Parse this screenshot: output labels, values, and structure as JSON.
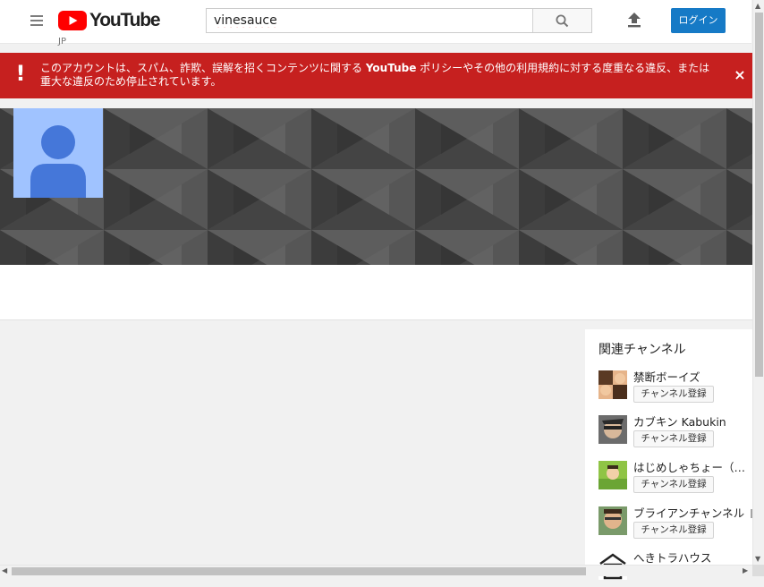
{
  "header": {
    "logo_text": "YouTube",
    "region": "JP",
    "search": {
      "value": "vinesauce",
      "placeholder": "検索"
    },
    "login_label": "ログイン",
    "brand_color": "#ff0000",
    "accent_color": "#167ac6"
  },
  "alert": {
    "icon": "!",
    "text_before": "このアカウントは、スパム、詐欺、誤解を招くコンテンツに関する ",
    "text_bold": "YouTube",
    "text_after": " ポリシーやその他の利用規約に対する度重なる違反、または重大な違反のため停止されています。",
    "close": "×",
    "color": "#c6201f"
  },
  "sidebar": {
    "title": "関連チャンネル",
    "subscribe_label": "チャンネル登録",
    "channels": [
      {
        "name": "禁断ボーイズ",
        "verified": false
      },
      {
        "name": "カブキン Kabukin",
        "verified": false
      },
      {
        "name": "はじめしゃちょー（hajime）",
        "verified": false
      },
      {
        "name": "ブライアンチャンネル",
        "verified": true
      },
      {
        "name": "へきトラハウス",
        "verified": false
      }
    ]
  },
  "icons": {
    "menu": "menu-icon",
    "search": "search-icon",
    "upload": "upload-icon",
    "close": "close-icon",
    "avatar": "default-avatar-icon",
    "verified": "verified-icon"
  }
}
